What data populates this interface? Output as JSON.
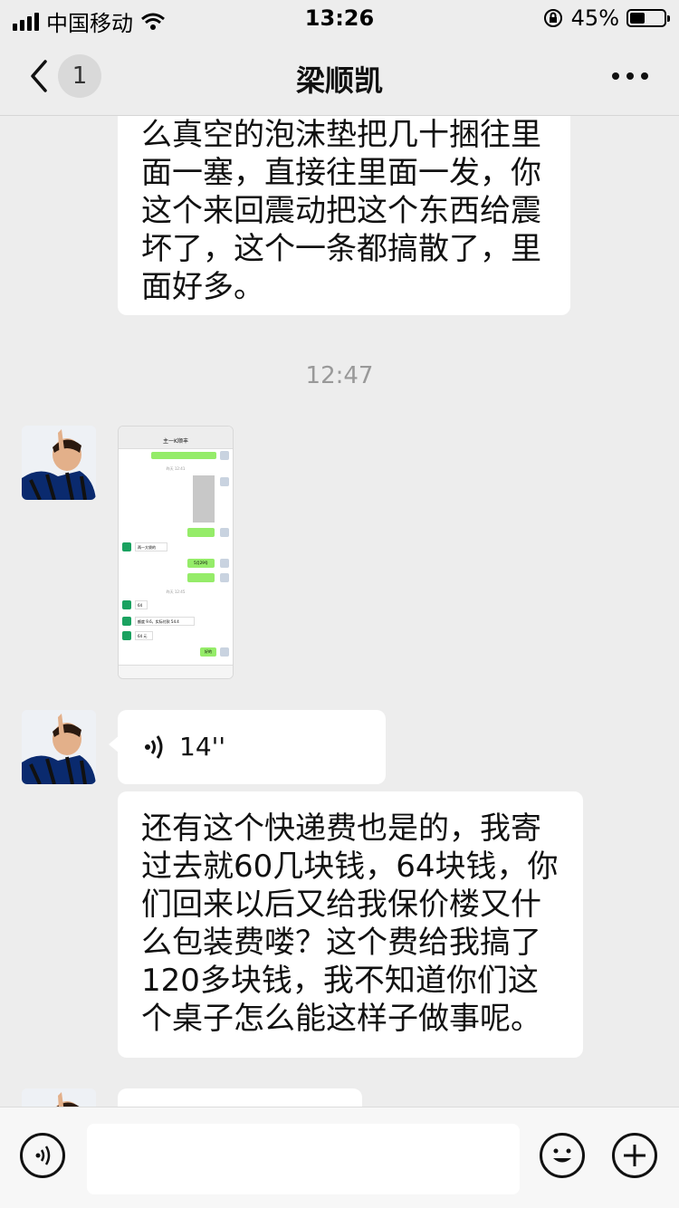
{
  "status_bar": {
    "carrier": "中国移动",
    "time": "13:26",
    "battery_percent": "45%",
    "battery_level": 0.45
  },
  "header": {
    "unread_count": "1",
    "title": "梁顺凯"
  },
  "messages": {
    "text_1": "么真空的泡沫垫把几十捆往里面一塞，直接往里面一发，你这个来回震动把这个东西给震坏了，这个一条都搞散了，里面好多。",
    "timestamp": "12:47",
    "voice_duration": "14''",
    "text_2": "还有这个快递费也是的，我寄过去就60几块钱，64块钱，你们回来以后又给我保价楼又什么包装费喽？这个费给我搞了120多块钱，我不知道你们这个桌子怎么能这样子做事呢。"
  },
  "thumbnail": {
    "title": "主一K顺丰",
    "time_a": "昨天 12:41",
    "time_b": "昨天 12:45",
    "msg_a": "两一大袋的",
    "msg_b": "5月29号",
    "msg_c": "64",
    "msg_d": "额度 9.6，实际付款 54.4",
    "msg_e": "64 元",
    "msg_f": "好的"
  },
  "colors": {
    "background": "#ededed",
    "bubble": "#ffffff",
    "self_bubble": "#95ec69"
  }
}
